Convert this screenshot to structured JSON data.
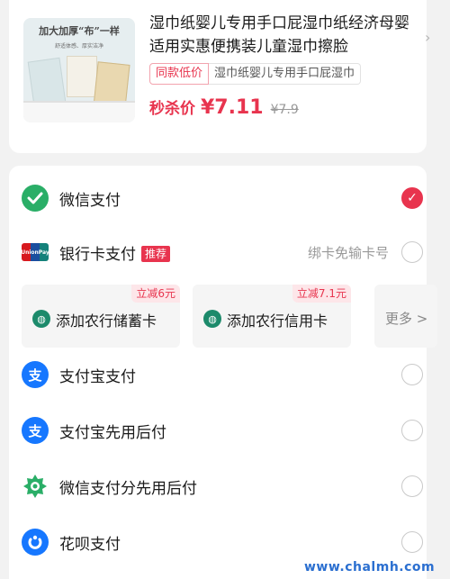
{
  "product": {
    "thumb_headline": "加大加厚“布”一样",
    "thumb_subline": "舒适体感、厚实洁净",
    "title": "湿巾纸婴儿专用手口屁湿巾纸经济母婴适用实惠便携装儿童湿巾擦脸",
    "tag_primary": "同款低价",
    "tag_secondary": "湿巾纸婴儿专用手口屁湿巾",
    "flash_label": "秒杀价",
    "price": "¥7.11",
    "original_price": "¥7.9"
  },
  "payments": {
    "wechat": {
      "label": "微信支付",
      "selected": true
    },
    "bank": {
      "label": "银行卡支付",
      "badge": "推荐",
      "hint": "绑卡免输卡号",
      "icon_text": "UnionPay"
    },
    "bank_cards": [
      {
        "label": "添加农行储蓄卡",
        "promo": "立减6元"
      },
      {
        "label": "添加农行信用卡",
        "promo": "立减7.1元"
      }
    ],
    "more_label": "更多 >",
    "alipay": {
      "label": "支付宝支付",
      "icon_text": "支"
    },
    "alipay_later": {
      "label": "支付宝先用后付",
      "icon_text": "支"
    },
    "wechat_score": {
      "label": "微信支付分先用后付"
    },
    "huabei": {
      "label": "花呗支付"
    }
  },
  "watermark": "www.chalmh.com",
  "colors": {
    "accent": "#e8344e",
    "wechat": "#2aae67",
    "alipay": "#1677ff",
    "abc": "#1c8a6b"
  }
}
